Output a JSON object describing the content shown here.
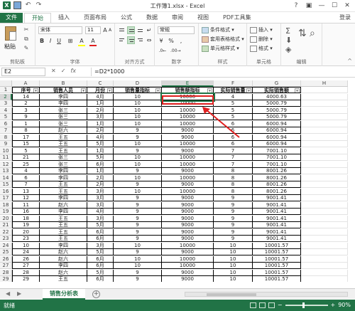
{
  "window": {
    "title": "工作簿1.xlsx - Excel",
    "controls": [
      "?",
      "▣",
      "—",
      "☐",
      "✕"
    ]
  },
  "tabs": [
    "文件",
    "开始",
    "插入",
    "页面布局",
    "公式",
    "数据",
    "审阅",
    "视图",
    "PDF工具集"
  ],
  "login": "登录",
  "ribbon": {
    "paste": "粘贴",
    "groups": [
      "剪贴板",
      "字体",
      "对齐方式",
      "数字",
      "样式",
      "单元格",
      "编辑"
    ],
    "font_name": "宋体",
    "font_size": "11",
    "number_format": "常规",
    "styles": [
      "条件格式 ▾",
      "套用表格格式 ▾",
      "单元格样式 ▾"
    ],
    "cells": [
      "插入 ▾",
      "删除 ▾",
      "格式 ▾"
    ],
    "font_buttons": [
      "B",
      "I",
      "U",
      "A",
      "A"
    ],
    "number_buttons": [
      "%",
      ","
    ]
  },
  "formula_bar": {
    "name_box": "E2",
    "formula": "=D2*1000",
    "icons": [
      "✕",
      "✓",
      "fx"
    ]
  },
  "columns": [
    "A",
    "B",
    "C",
    "D",
    "E",
    "F",
    "G",
    "H"
  ],
  "headers": [
    "序号",
    "销售人员",
    "月份",
    "销售量指标",
    "销售额指标",
    "实际销售量",
    "实际销售额"
  ],
  "rows": [
    [
      "14",
      "李四",
      "4月",
      "10",
      "10000",
      "4",
      "4000.63"
    ],
    [
      "2",
      "李四",
      "1月",
      "10",
      "10000",
      "5",
      "5000.79"
    ],
    [
      "3",
      "张三",
      "2月",
      "10",
      "10000",
      "5",
      "5000.79"
    ],
    [
      "9",
      "张三",
      "3月",
      "10",
      "10000",
      "5",
      "5000.79"
    ],
    [
      "1",
      "张三",
      "1月",
      "10",
      "10000",
      "6",
      "6000.94"
    ],
    [
      "8",
      "赵六",
      "2月",
      "9",
      "9000",
      "6",
      "6000.94"
    ],
    [
      "17",
      "王五",
      "4月",
      "9",
      "9000",
      "6",
      "6000.94"
    ],
    [
      "15",
      "王五",
      "5月",
      "10",
      "10000",
      "6",
      "6000.94"
    ],
    [
      "5",
      "王五",
      "1月",
      "9",
      "9000",
      "7",
      "7001.10"
    ],
    [
      "21",
      "张三",
      "5月",
      "10",
      "10000",
      "7",
      "7001.10"
    ],
    [
      "25",
      "张三",
      "6月",
      "10",
      "10000",
      "7",
      "7001.10"
    ],
    [
      "4",
      "李四",
      "1月",
      "9",
      "9000",
      "8",
      "8001.26"
    ],
    [
      "6",
      "李四",
      "2月",
      "10",
      "10000",
      "8",
      "8001.26"
    ],
    [
      "7",
      "王五",
      "2月",
      "9",
      "9000",
      "8",
      "8001.26"
    ],
    [
      "13",
      "王五",
      "3月",
      "10",
      "10000",
      "8",
      "8001.26"
    ],
    [
      "12",
      "李四",
      "3月",
      "9",
      "9000",
      "9",
      "9001.41"
    ],
    [
      "11",
      "赵六",
      "3月",
      "9",
      "9000",
      "9",
      "9001.41"
    ],
    [
      "16",
      "李四",
      "4月",
      "9",
      "9000",
      "9",
      "9001.41"
    ],
    [
      "18",
      "王五",
      "3月",
      "9",
      "9000",
      "9",
      "9001.41"
    ],
    [
      "19",
      "王五",
      "5月",
      "9",
      "9000",
      "9",
      "9001.41"
    ],
    [
      "20",
      "王五",
      "6月",
      "9",
      "9000",
      "9",
      "9001.41"
    ],
    [
      "23",
      "王五",
      "6月",
      "9",
      "9000",
      "9",
      "9001.41"
    ],
    [
      "10",
      "李四",
      "3月",
      "10",
      "10000",
      "10",
      "10001.57"
    ],
    [
      "24",
      "赵六",
      "5月",
      "9",
      "9000",
      "10",
      "10001.57"
    ],
    [
      "26",
      "赵六",
      "6月",
      "10",
      "10000",
      "10",
      "10001.57"
    ],
    [
      "27",
      "李四",
      "6月",
      "10",
      "10000",
      "10",
      "10001.57"
    ],
    [
      "28",
      "赵六",
      "5月",
      "9",
      "9000",
      "10",
      "10001.57"
    ],
    [
      "29",
      "王五",
      "6月",
      "9",
      "9000",
      "10",
      "10001.57"
    ]
  ],
  "row_numbers": [
    "1",
    "2",
    "3",
    "4",
    "5",
    "6",
    "7",
    "8",
    "9",
    "10",
    "11",
    "12",
    "13",
    "14",
    "15",
    "16",
    "17",
    "18",
    "19",
    "20",
    "21",
    "22",
    "23",
    "24",
    "25",
    "26",
    "27",
    "28",
    "29"
  ],
  "sheet_tab": "销售分析表",
  "status": "就绪",
  "zoom": "90%",
  "colors": {
    "accent": "#217346",
    "highlight_box": "#e02020"
  }
}
